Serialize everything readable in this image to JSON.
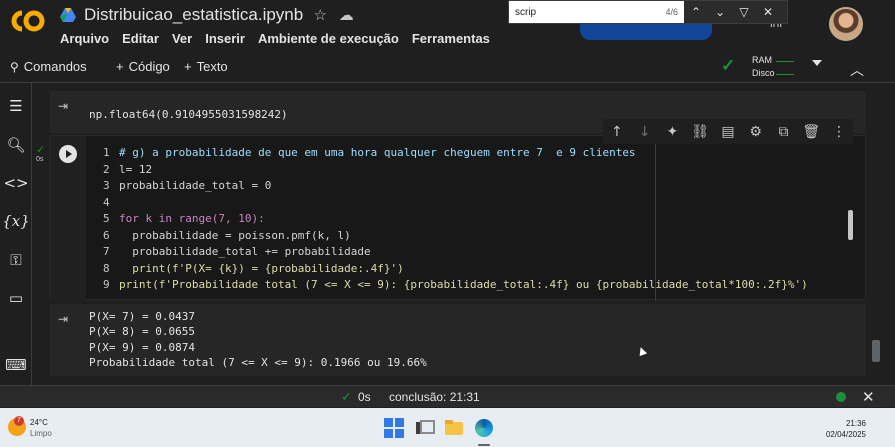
{
  "header": {
    "notebook_title": "Distribuicao_estatistica.ipynb",
    "share_fragment": "ini",
    "menu": [
      "Arquivo",
      "Editar",
      "Ver",
      "Inserir",
      "Ambiente de execução",
      "Ferramentas"
    ]
  },
  "find": {
    "query": "scrip",
    "count": "4/6"
  },
  "toolbar": {
    "commands_label": "Comandos",
    "code_label": "Código",
    "text_label": "Texto",
    "ram_label": "RAM",
    "disk_label": "Disco"
  },
  "output_top": "np.float64(0.9104955031598242)",
  "cell": {
    "time": "0s",
    "lines": [
      {
        "n": "1",
        "text": "# g) a probabilidade de que em uma hora qualquer cheguem entre 7  e 9 clientes"
      },
      {
        "n": "2",
        "text": "l= 12"
      },
      {
        "n": "3",
        "text": "probabilidade_total = 0"
      },
      {
        "n": "4",
        "text": ""
      },
      {
        "n": "5",
        "text": "for k in range(7, 10):"
      },
      {
        "n": "6",
        "text": "  probabilidade = poisson.pmf(k, l)"
      },
      {
        "n": "7",
        "text": "  probabilidade_total += probabilidade"
      },
      {
        "n": "8",
        "text": "  print(f'P(X= {k}) = {probabilidade:.4f}')"
      },
      {
        "n": "9",
        "text": "print(f'Probabilidade total (7 <= X <= 9): {probabilidade_total:.4f} ou {probabilidade_total*100:.2f}%')"
      }
    ]
  },
  "output_bottom": [
    "P(X= 7) = 0.0437",
    "P(X= 8) = 0.0655",
    "P(X= 9) = 0.0874",
    "Probabilidade total (7 <= X <= 9): 0.1966 ou 19.66%"
  ],
  "statusbar": {
    "duration": "0s",
    "conclusion": "conclusão: 21:31"
  },
  "taskbar": {
    "weather_badge": "7",
    "temperature": "24°C",
    "condition": "Limpo",
    "time": "21:36",
    "date": "02/04/2025"
  },
  "colors": {
    "accent_green": "#1e8e3e",
    "logo_orange": "#f9ab00",
    "background": "#1f1f1f"
  }
}
